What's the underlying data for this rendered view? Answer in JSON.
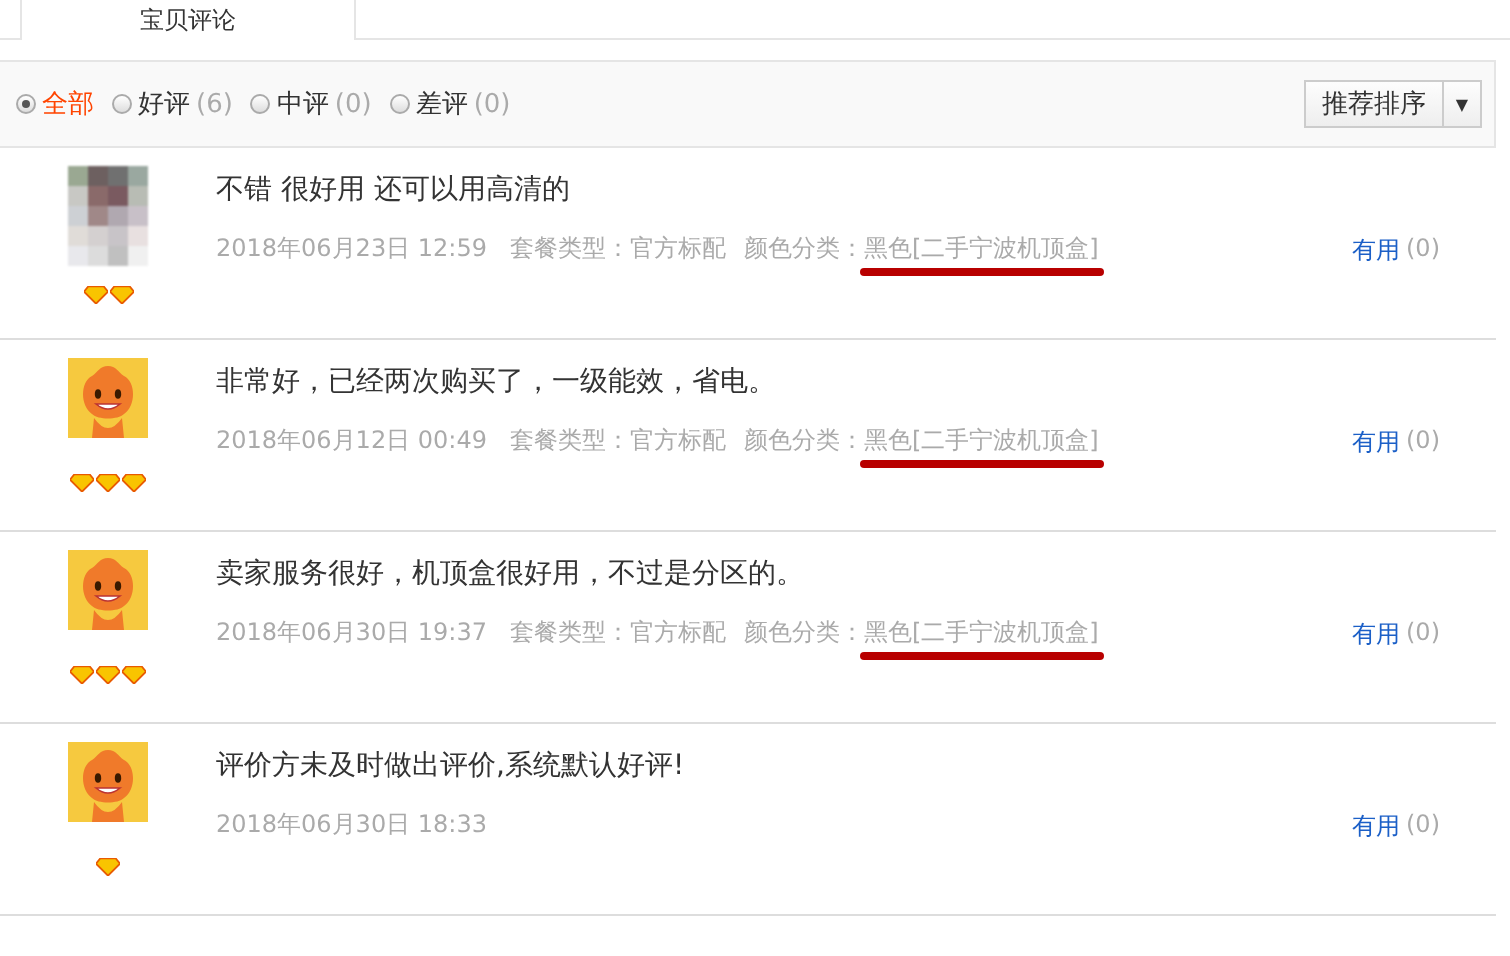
{
  "tabs": [
    {
      "label": "宝贝评论",
      "selected": true
    }
  ],
  "filters": [
    {
      "label": "全部",
      "selected": true
    },
    {
      "label": "好评",
      "count": "(6)",
      "selected": false
    },
    {
      "label": "中评",
      "count": "(0)",
      "selected": false
    },
    {
      "label": "差评",
      "count": "(0)",
      "selected": false
    }
  ],
  "sort": {
    "label": "推荐排序",
    "caret": "▼"
  },
  "reviews": [
    {
      "kind": "photo",
      "level_icons": [
        {
          "kind": "diamond"
        },
        {
          "kind": "diamond"
        }
      ],
      "text": "不错 很好用 还可以用高清的",
      "date": "2018年06月23日 12:59",
      "package": "套餐类型：官方标配",
      "color_label": "颜色分类：",
      "color_value": "黑色[二手宁波机顶盒]",
      "underlined": true,
      "useful": "有用",
      "useful_count": "(0)"
    },
    {
      "kind": "mascot",
      "level_icons": [
        {
          "kind": "diamond"
        },
        {
          "kind": "diamond"
        },
        {
          "kind": "diamond"
        }
      ],
      "text": "非常好，已经两次购买了，一级能效，省电。",
      "date": "2018年06月12日 00:49",
      "package": "套餐类型：官方标配",
      "color_label": "颜色分类：",
      "color_value": "黑色[二手宁波机顶盒]",
      "underlined": true,
      "useful": "有用",
      "useful_count": "(0)"
    },
    {
      "kind": "mascot",
      "level_icons": [
        {
          "kind": "diamond"
        },
        {
          "kind": "diamond"
        },
        {
          "kind": "diamond"
        }
      ],
      "text": "卖家服务很好，机顶盒很好用，不过是分区的。",
      "date": "2018年06月30日 19:37",
      "package": "套餐类型：官方标配",
      "color_label": "颜色分类：",
      "color_value": "黑色[二手宁波机顶盒]",
      "underlined": true,
      "useful": "有用",
      "useful_count": "(0)"
    },
    {
      "kind": "mascot",
      "level_icons": [
        {
          "kind": "diamond"
        }
      ],
      "text": "评价方未及时做出评价,系统默认好评!",
      "date": "2018年06月30日 18:33",
      "useful": "有用",
      "useful_count": "(0)"
    }
  ]
}
